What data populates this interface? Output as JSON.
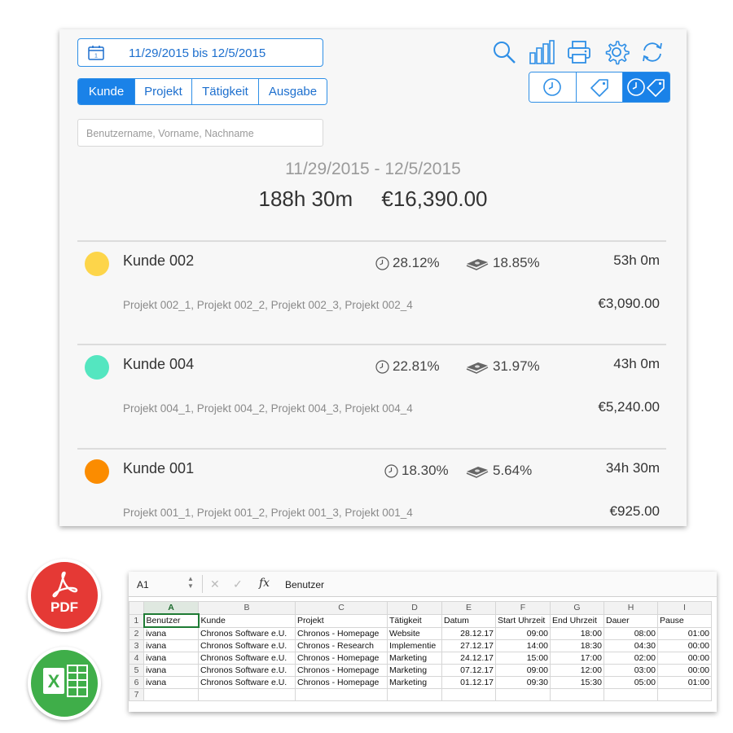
{
  "app": {
    "date_range_button": "11/29/2015 bis 12/5/2015",
    "calendar_day": "1",
    "tabs": [
      {
        "label": "Kunde",
        "active": true
      },
      {
        "label": "Projekt",
        "active": false
      },
      {
        "label": "Tätigkeit",
        "active": false
      },
      {
        "label": "Ausgabe",
        "active": false
      }
    ],
    "search_placeholder": "Benutzername, Vorname, Nachname",
    "toolbar_icons": [
      "search-icon",
      "bar-chart-icon",
      "printer-icon",
      "gear-icon",
      "refresh-icon"
    ],
    "view_toggle": [
      {
        "icon": "clock-icon",
        "active": false
      },
      {
        "icon": "price-tag-icon",
        "active": false
      },
      {
        "icon": "clock-tag-icon",
        "active": true
      }
    ],
    "summary": {
      "range": "11/29/2015 - 12/5/2015",
      "total_time": "188h 30m",
      "total_amount": "€16,390.00"
    },
    "rows": [
      {
        "name": "Kunde 002",
        "color": "#fdd54a",
        "time_pct": "28.12%",
        "money_pct": "18.85%",
        "hours": "53h 0m",
        "projects": "Projekt 002_1, Projekt 002_2, Projekt 002_3, Projekt 002_4",
        "amount": "€3,090.00"
      },
      {
        "name": "Kunde 004",
        "color": "#54e6c0",
        "time_pct": "22.81%",
        "money_pct": "31.97%",
        "hours": "43h 0m",
        "projects": "Projekt 004_1, Projekt 004_2, Projekt 004_3, Projekt 004_4",
        "amount": "€5,240.00"
      },
      {
        "name": "Kunde 001",
        "color": "#fb8c00",
        "time_pct": "18.30%",
        "money_pct": "5.64%",
        "hours": "34h 30m",
        "projects": "Projekt 001_1, Projekt 001_2, Projekt 001_3, Projekt 001_4",
        "amount": "€925.00"
      }
    ]
  },
  "badges": {
    "pdf_label": "PDF",
    "excel_label": "X"
  },
  "spreadsheet": {
    "cell_ref": "A1",
    "formula_value": "Benutzer",
    "columns": [
      "A",
      "B",
      "C",
      "D",
      "E",
      "F",
      "G",
      "H",
      "I"
    ],
    "rows": [
      [
        "Benutzer",
        "Kunde",
        "Projekt",
        "Tätigkeit",
        "Datum",
        "Start Uhrzeit",
        "End Uhrzeit",
        "Dauer",
        "Pause"
      ],
      [
        "ivana",
        "Chronos Software e.U.",
        "Chronos - Homepage",
        "Website",
        "28.12.17",
        "09:00",
        "18:00",
        "08:00",
        "01:00"
      ],
      [
        "ivana",
        "Chronos Software e.U.",
        "Chronos - Research",
        "Implementie",
        "27.12.17",
        "14:00",
        "18:30",
        "04:30",
        "00:00"
      ],
      [
        "ivana",
        "Chronos Software e.U.",
        "Chronos - Homepage",
        "Marketing",
        "24.12.17",
        "15:00",
        "17:00",
        "02:00",
        "00:00"
      ],
      [
        "ivana",
        "Chronos Software e.U.",
        "Chronos - Homepage",
        "Marketing",
        "07.12.17",
        "09:00",
        "12:00",
        "03:00",
        "00:00"
      ],
      [
        "ivana",
        "Chronos Software e.U.",
        "Chronos - Homepage",
        "Marketing",
        "01.12.17",
        "09:30",
        "15:30",
        "05:00",
        "01:00"
      ],
      [
        "",
        "",
        "",
        "",
        "",
        "",
        "",
        "",
        ""
      ]
    ]
  }
}
